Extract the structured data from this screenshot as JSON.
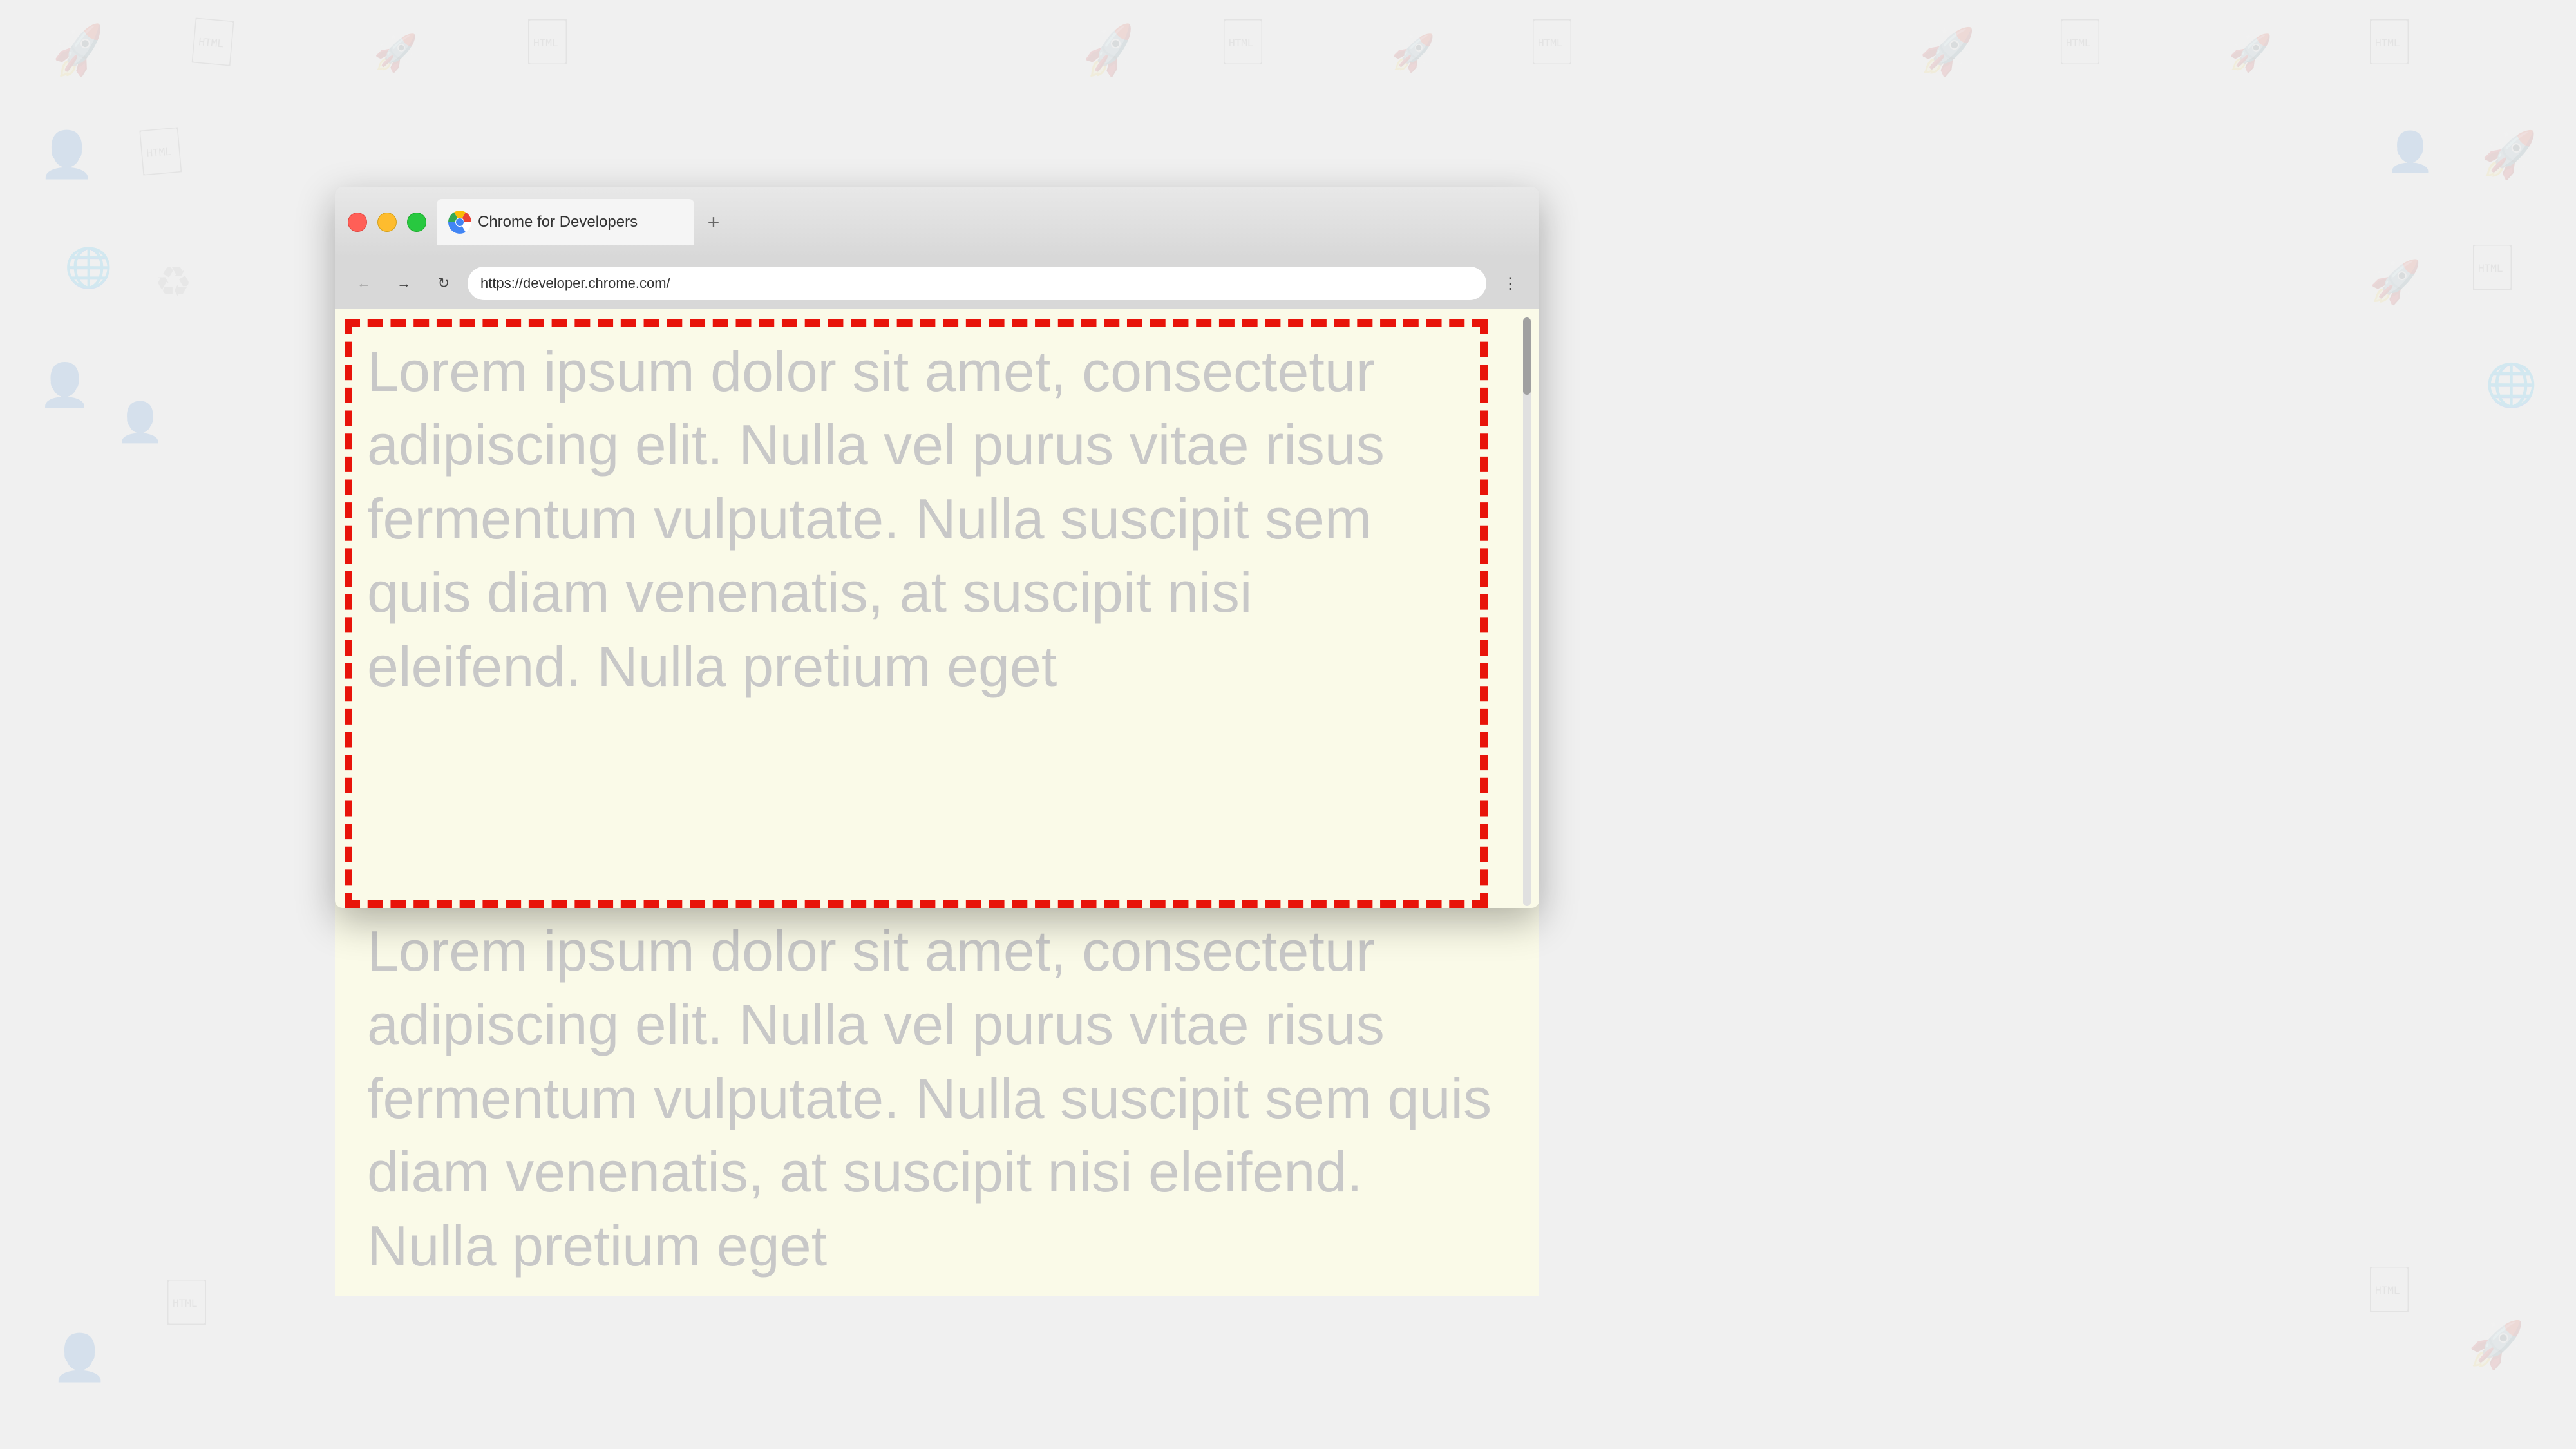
{
  "browser": {
    "traffic_lights": {
      "red": "red",
      "yellow": "yellow",
      "green": "green"
    },
    "tab": {
      "title": "Chrome for Developers",
      "favicon": "chrome-icon"
    },
    "new_tab_button_label": "+",
    "nav": {
      "back_label": "←",
      "forward_label": "→",
      "refresh_label": "↻",
      "url": "https://developer.chrome.com/",
      "menu_label": "⋮"
    },
    "content": {
      "lorem_text": "Lorem ipsum dolor sit amet, consectetur adipiscing elit. Nulla vel purus vitae risus fermentum vulputate. Nulla suscipit sem quis diam venenatis, at suscipit nisi eleifend. Nulla pretium eget",
      "background_color": "#fafae8",
      "border_color": "#e8140a"
    }
  },
  "background": {
    "color": "#f0f0f0"
  }
}
